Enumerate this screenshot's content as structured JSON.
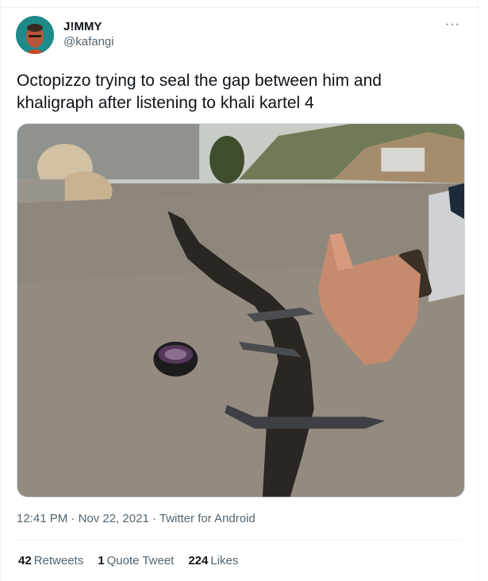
{
  "author": {
    "display_name": "J!MMY",
    "handle": "@kafangi",
    "avatar_icon": "profile-avatar-icon"
  },
  "more_label": "···",
  "tweet": {
    "text": "Octopizzo trying to seal the gap between him and khaligraph after listening to khali kartel 4"
  },
  "media": {
    "icon": "photo-image"
  },
  "meta": {
    "time": "12:41 PM",
    "separator": "·",
    "date": "Nov 22, 2021",
    "source": "Twitter for Android"
  },
  "stats": {
    "retweets_count": "42",
    "retweets_label": "Retweets",
    "quote_count": "1",
    "quote_label": "Quote Tweet",
    "likes_count": "224",
    "likes_label": "Likes"
  },
  "colors": {
    "text_primary": "#0f1419",
    "text_secondary": "#536471",
    "border": "#eff3f4",
    "avatar_bg": "#1f8a8a"
  }
}
